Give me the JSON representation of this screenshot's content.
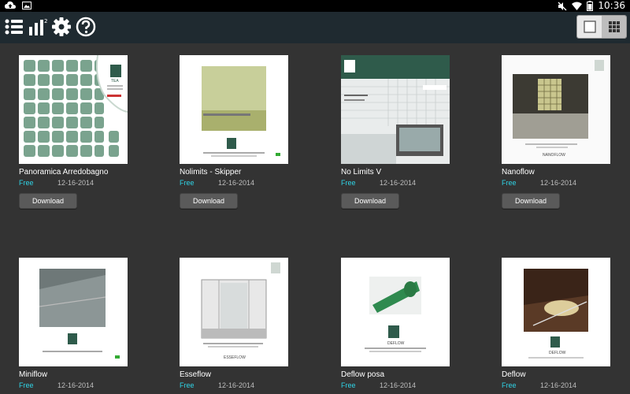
{
  "statusbar": {
    "time": "10:36"
  },
  "toolbar": {
    "list_icon": "list-icon",
    "stats_icon": "bar-chart-icon",
    "settings_icon": "gear-icon",
    "help_icon": "help-icon"
  },
  "view_toggle": {
    "single": "single-view-icon",
    "grid": "grid-view-icon"
  },
  "catalogs": [
    {
      "title": "Panoramica Arredobagno",
      "price": "Free",
      "date": "12-16-2014",
      "button": "Download"
    },
    {
      "title": "Nolimits - Skipper",
      "price": "Free",
      "date": "12-16-2014",
      "button": "Download"
    },
    {
      "title": "No Limits V",
      "price": "Free",
      "date": "12-16-2014",
      "button": "Download"
    },
    {
      "title": "Nanoflow",
      "price": "Free",
      "date": "12-16-2014",
      "button": "Download"
    },
    {
      "title": "Miniflow",
      "price": "Free",
      "date": "12-16-2014"
    },
    {
      "title": "Esseflow",
      "price": "Free",
      "date": "12-16-2014"
    },
    {
      "title": "Deflow posa",
      "price": "Free",
      "date": "12-16-2014"
    },
    {
      "title": "Deflow",
      "price": "Free",
      "date": "12-16-2014"
    }
  ],
  "cover_texts": {
    "brand": "TEA",
    "skipper_caption": "NOLIMITS SKIPPER",
    "nanoflow_caption": "NANOFLOW",
    "miniflow_caption": "MINIFLOW",
    "esseflow_caption": "ESSEFLOW",
    "deflow_posa_caption": "DEFLOW",
    "deflow_caption": "DEFLOW"
  },
  "colors": {
    "accent": "#2fd3e6",
    "background": "#333333",
    "actionbar": "#1f2a30"
  }
}
